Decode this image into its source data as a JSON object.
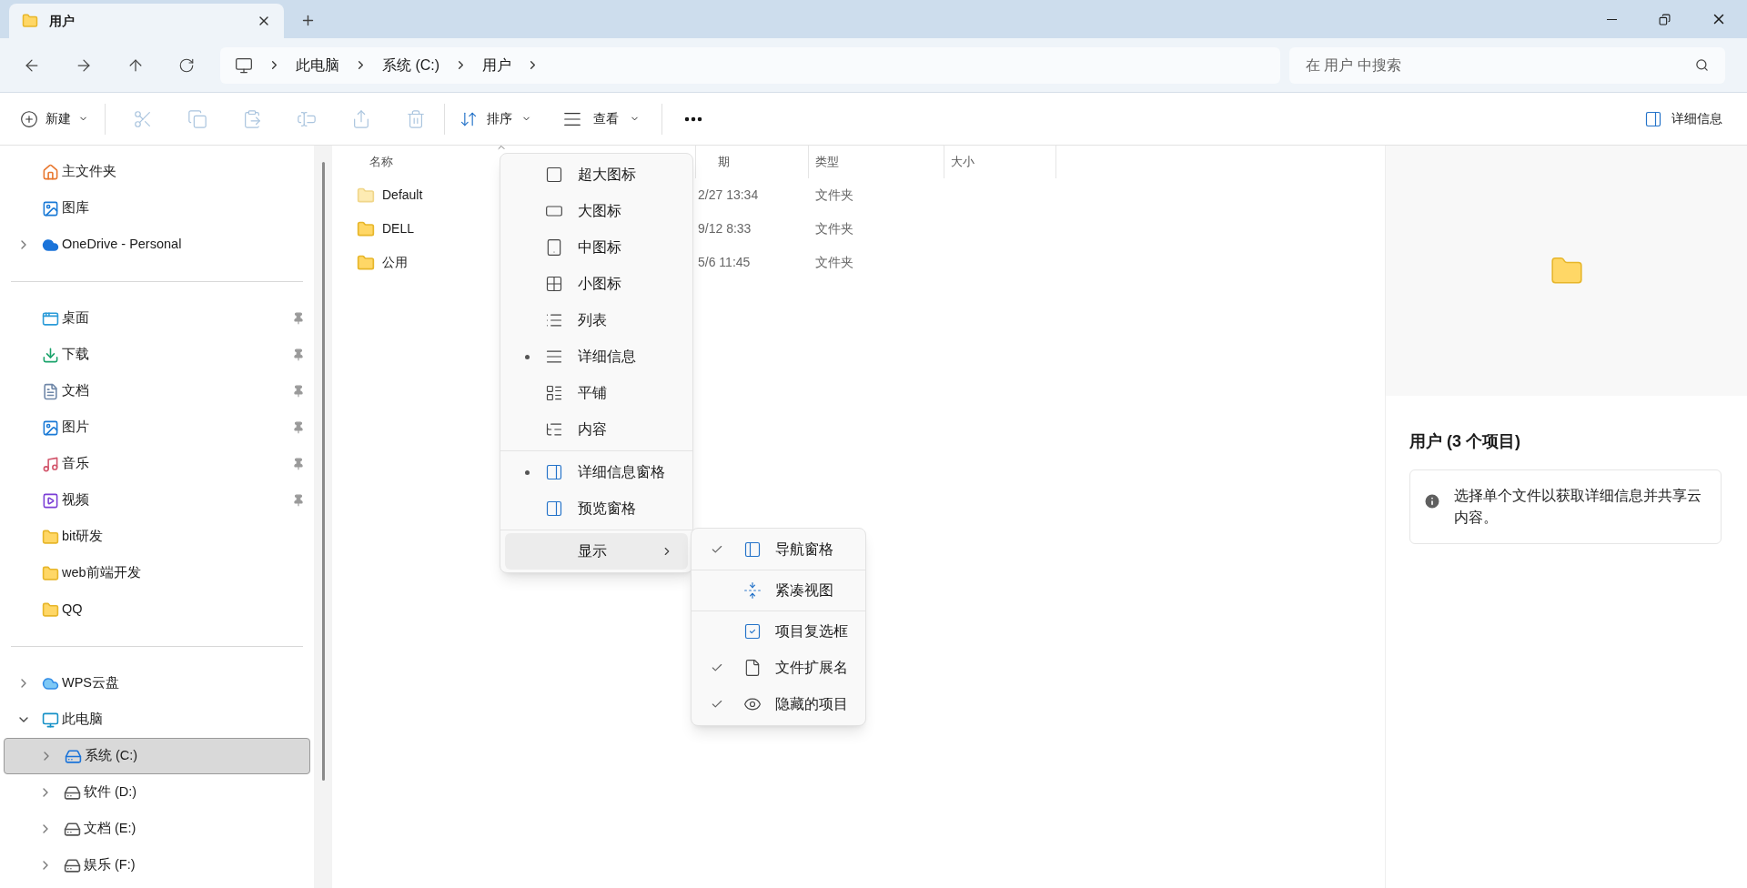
{
  "tabs": [
    {
      "title": "用户",
      "selected": true
    }
  ],
  "address": {
    "segments": [
      "此电脑",
      "系统 (C:)",
      "用户"
    ]
  },
  "search": {
    "placeholder": "在 用户 中搜索"
  },
  "toolbar": {
    "new_label": "新建",
    "actions": [
      {
        "kind": "cut",
        "disabled": true
      },
      {
        "kind": "copy",
        "disabled": true
      },
      {
        "kind": "paste",
        "disabled": true
      },
      {
        "kind": "rename",
        "disabled": true
      },
      {
        "kind": "share",
        "disabled": true
      },
      {
        "kind": "delete",
        "disabled": true
      }
    ],
    "sort_label": "排序",
    "view_label": "查看",
    "details_label": "详细信息"
  },
  "sidebar": {
    "groups": [
      [
        {
          "label": "主文件夹",
          "kind": "home",
          "selected": false
        },
        {
          "label": "图库",
          "kind": "gallery",
          "selected": false
        },
        {
          "label": "OneDrive - Personal",
          "kind": "onedrive",
          "selected": false,
          "expanded": false
        }
      ],
      [
        {
          "label": "桌面",
          "kind": "desktop",
          "selected": false,
          "pinned": true
        },
        {
          "label": "下载",
          "kind": "download",
          "selected": false,
          "pinned": true
        },
        {
          "label": "文档",
          "kind": "document",
          "selected": false,
          "pinned": true
        },
        {
          "label": "图片",
          "kind": "pictures",
          "selected": false,
          "pinned": true
        },
        {
          "label": "音乐",
          "kind": "music",
          "selected": false,
          "pinned": true
        },
        {
          "label": "视频",
          "kind": "video",
          "selected": false,
          "pinned": true
        },
        {
          "label": "bit研发",
          "kind": "folder",
          "selected": false,
          "pinned": false
        },
        {
          "label": "web前端开发",
          "kind": "folder",
          "selected": false,
          "pinned": false
        },
        {
          "label": "QQ",
          "kind": "folder",
          "selected": false,
          "pinned": false
        }
      ],
      [
        {
          "label": "WPS云盘",
          "kind": "wps",
          "selected": false,
          "expanded": false
        },
        {
          "label": "此电脑",
          "kind": "pc",
          "selected": false,
          "expanded": true,
          "children": [
            {
              "label": "系统 (C:)",
              "kind": "system-drive",
              "selected": true,
              "expanded": false
            },
            {
              "label": "软件 (D:)",
              "kind": "drive",
              "selected": false,
              "expanded": false
            },
            {
              "label": "文档 (E:)",
              "kind": "drive",
              "selected": false,
              "expanded": false
            },
            {
              "label": "娱乐 (F:)",
              "kind": "drive",
              "selected": false,
              "expanded": false
            }
          ]
        }
      ]
    ]
  },
  "file_list": {
    "columns": [
      {
        "label": "名称",
        "sorted": true
      },
      {
        "label": "期",
        "sorted": false
      },
      {
        "label": "类型",
        "sorted": false
      },
      {
        "label": "大小",
        "sorted": false
      }
    ],
    "rows": [
      {
        "name": "Default",
        "modified": "2/27 13:34",
        "type": "文件夹",
        "faded": true
      },
      {
        "name": "DELL",
        "modified": "9/12 8:33",
        "type": "文件夹",
        "faded": false
      },
      {
        "name": "公用",
        "modified": "5/6 11:45",
        "type": "文件夹",
        "faded": false
      }
    ]
  },
  "view_menu": {
    "groups": [
      [
        {
          "label": "超大图标",
          "kind": "extra-large",
          "selected": false,
          "highlighted": false
        },
        {
          "label": "大图标",
          "kind": "large",
          "selected": false,
          "highlighted": false
        },
        {
          "label": "中图标",
          "kind": "medium",
          "selected": false,
          "highlighted": false
        },
        {
          "label": "小图标",
          "kind": "small",
          "selected": false,
          "highlighted": false
        },
        {
          "label": "列表",
          "kind": "list",
          "selected": false,
          "highlighted": false
        },
        {
          "label": "详细信息",
          "kind": "details",
          "selected": true,
          "highlighted": false
        },
        {
          "label": "平铺",
          "kind": "tiles",
          "selected": false,
          "highlighted": false
        },
        {
          "label": "内容",
          "kind": "content",
          "selected": false,
          "highlighted": false
        }
      ],
      [
        {
          "label": "详细信息窗格",
          "kind": "details-pane",
          "selected": true,
          "highlighted": false
        },
        {
          "label": "预览窗格",
          "kind": "preview-pane",
          "selected": false,
          "highlighted": false
        }
      ],
      [
        {
          "label": "显示",
          "kind": "submenu",
          "selected": false,
          "highlighted": true
        }
      ]
    ]
  },
  "show_submenu": {
    "groups": [
      [
        {
          "label": "导航窗格",
          "kind": "nav-pane",
          "checked": true
        }
      ],
      [
        {
          "label": "紧凑视图",
          "kind": "compact",
          "checked": false
        }
      ],
      [
        {
          "label": "项目复选框",
          "kind": "checkbox",
          "checked": false
        },
        {
          "label": "文件扩展名",
          "kind": "extension",
          "checked": true
        },
        {
          "label": "隐藏的项目",
          "kind": "hidden",
          "checked": true
        }
      ]
    ]
  },
  "details_pane": {
    "title": "用户 (3 个项目)",
    "info": "选择单个文件以获取详细信息并共享云内容。"
  }
}
